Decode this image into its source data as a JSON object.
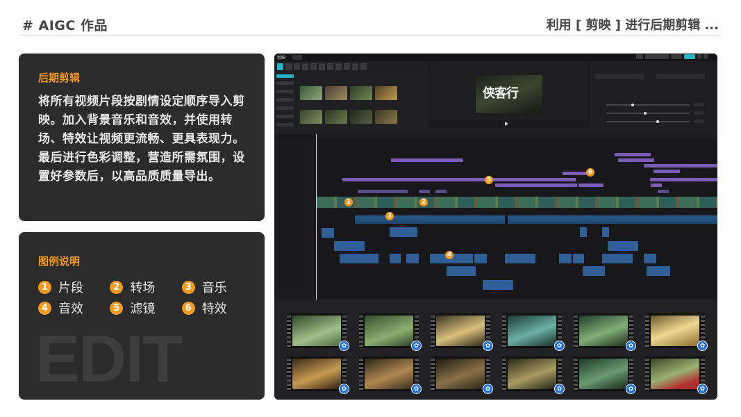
{
  "header": {
    "left": "# AIGC 作品",
    "right": "利用 [ 剪映 ] 进行后期剪辑 ..."
  },
  "post_edit": {
    "title": "后期剪辑",
    "body": "将所有视频片段按剧情设定顺序导入剪映。加入背景音乐和音效，并使用转场、特效让视频更流畅、更具表现力。最后进行色彩调整，营造所需氛围，设置好参数后，以高品质质量导出。"
  },
  "legend": {
    "title": "图例说明",
    "items": [
      {
        "num": "1",
        "label": "片段"
      },
      {
        "num": "2",
        "label": "转场"
      },
      {
        "num": "3",
        "label": "音乐"
      },
      {
        "num": "4",
        "label": "音效"
      },
      {
        "num": "5",
        "label": "滤镜"
      },
      {
        "num": "6",
        "label": "特效"
      }
    ],
    "watermark": "EDIT"
  },
  "editor": {
    "app_name": "剪映",
    "player_title": "侠客行",
    "badges": [
      "1",
      "2",
      "3",
      "4",
      "5",
      "6"
    ],
    "accent": "#1fb4c8",
    "badge_color": "#f39a1e"
  },
  "colors": {
    "accent_orange": "#f39a1e",
    "card_bg": "#2b2b2b",
    "editor_bg": "#1b1b1d",
    "clip_purple": "#6a4fa0",
    "clip_blue": "#2c5a8f",
    "clip_teal": "#2f8f8f"
  }
}
